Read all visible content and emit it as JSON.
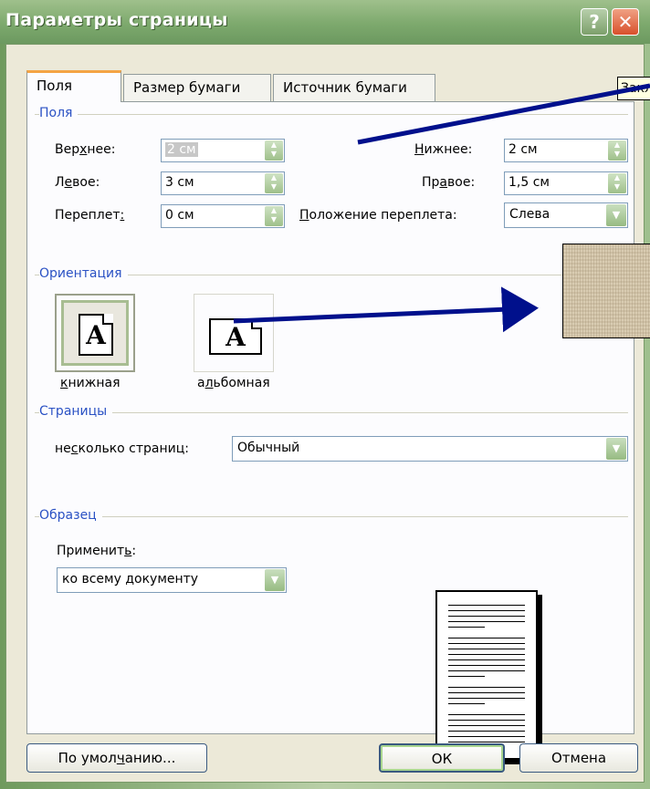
{
  "window": {
    "title": "Параметры страницы",
    "help_label": "?",
    "close_label": "✕"
  },
  "tabs": [
    {
      "label": "Поля",
      "active": true
    },
    {
      "label": "Размер бумаги",
      "active": false
    },
    {
      "label": "Источник бумаги",
      "active": false
    }
  ],
  "tooltip": "Закладки",
  "margins": {
    "group_title": "Поля",
    "top": {
      "label_a": "Вер",
      "label_u": "х",
      "label_b": "нее:",
      "value": "2 см"
    },
    "bottom": {
      "label_a": "",
      "label_u": "Н",
      "label_b": "ижнее:",
      "value": "2 см"
    },
    "left": {
      "label_a": "Л",
      "label_u": "е",
      "label_b": "вое:",
      "value": "3 см"
    },
    "right": {
      "label_a": "Пр",
      "label_u": "а",
      "label_b": "вое:",
      "value": "1,5 см"
    },
    "gutter": {
      "label_a": "Переплет",
      "label_u": ":",
      "label_b": "",
      "value": "0 см"
    },
    "gutter_position": {
      "label_u": "П",
      "label_b": "оложение переплета:",
      "value": "Слева"
    }
  },
  "orientation": {
    "group_title": "Ориентация",
    "portrait": {
      "label_u": "к",
      "label_b": "нижная",
      "glyph": "A",
      "selected": true
    },
    "landscape": {
      "label_a": "а",
      "label_u": "л",
      "label_b": "ьбомная",
      "glyph": "A",
      "selected": false
    }
  },
  "pages": {
    "group_title": "Страницы",
    "label_a": "не",
    "label_u": "с",
    "label_b": "колько страниц:",
    "value": "Обычный"
  },
  "sample": {
    "group_title": "Образец",
    "apply_label_a": "Применит",
    "apply_label_u": "ь",
    "apply_label_b": ":",
    "apply_value": "ко всему документу"
  },
  "buttons": {
    "default_a": "По умол",
    "default_u": "ч",
    "default_b": "анию...",
    "ok": "ОК",
    "cancel": "Отмена"
  },
  "colors": {
    "accent_blue": "#00108c",
    "group_title": "#2b52c4",
    "dialog_bg": "#ece9d8"
  }
}
